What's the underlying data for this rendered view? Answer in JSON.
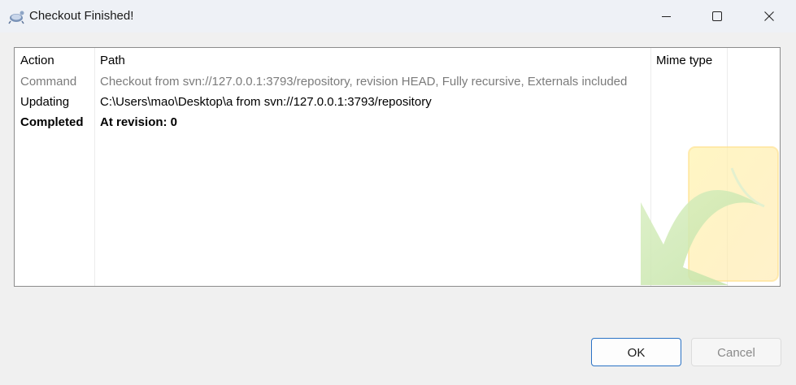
{
  "window": {
    "title": "Checkout Finished!",
    "title_icon": "tortoisesvn-icon"
  },
  "window_controls": {
    "minimize_icon": "minimize-icon",
    "maximize_icon": "maximize-icon",
    "close_icon": "close-icon"
  },
  "list": {
    "columns": [
      "Action",
      "Path",
      "Mime type"
    ],
    "rows": [
      {
        "action": "Command",
        "path": "Checkout from svn://127.0.0.1:3793/repository, revision HEAD, Fully recursive, Externals included",
        "mime": "",
        "style": "command"
      },
      {
        "action": "Updating",
        "path": "C:\\Users\\mao\\Desktop\\a from svn://127.0.0.1:3793/repository",
        "mime": "",
        "style": "normal"
      },
      {
        "action": "Completed",
        "path": "At revision: 0",
        "mime": "",
        "style": "completed"
      }
    ],
    "watermark_icon": "checkmark-arrow-icon"
  },
  "buttons": {
    "ok_label": "OK",
    "cancel_label": "Cancel"
  },
  "colors": {
    "titlebar": "#eef1f6",
    "background": "#f0f0f0",
    "ok_border": "#2a72c5",
    "disabled_text": "#8a8a8a",
    "command_text": "#7b7b7b"
  }
}
